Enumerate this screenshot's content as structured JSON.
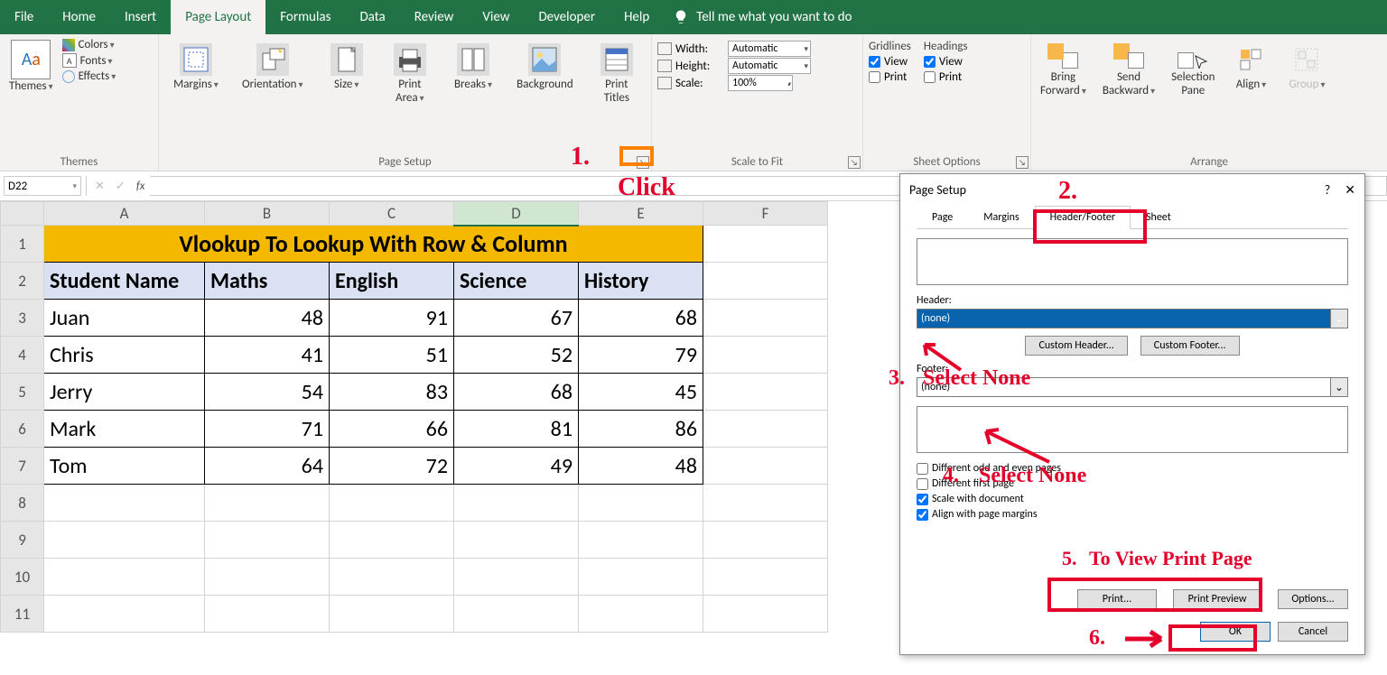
{
  "menubar": {
    "tabs": [
      "File",
      "Home",
      "Insert",
      "Page Layout",
      "Formulas",
      "Data",
      "Review",
      "View",
      "Developer",
      "Help"
    ],
    "active": "Page Layout",
    "tellme": "Tell me what you want to do"
  },
  "ribbon": {
    "themes": {
      "title": "Themes",
      "btn": "Themes",
      "colors": "Colors",
      "fonts": "Fonts",
      "effects": "Effects"
    },
    "page_setup": {
      "title": "Page Setup",
      "margins": "Margins",
      "orientation": "Orientation",
      "size": "Size",
      "print_area": "Print\nArea",
      "breaks": "Breaks",
      "background": "Background",
      "print_titles": "Print\nTitles"
    },
    "scale_to_fit": {
      "title": "Scale to Fit",
      "width": "Width:",
      "height": "Height:",
      "scale": "Scale:",
      "width_val": "Automatic",
      "height_val": "Automatic",
      "scale_val": "100%"
    },
    "sheet_options": {
      "title": "Sheet Options",
      "gridlines": "Gridlines",
      "headings": "Headings",
      "view": "View",
      "print": "Print"
    },
    "arrange": {
      "title": "Arrange",
      "bring_forward": "Bring\nForward",
      "send_backward": "Send\nBackward",
      "selection_pane": "Selection\nPane",
      "align": "Align",
      "group": "Group"
    }
  },
  "namebox": "D22",
  "columns": [
    "A",
    "B",
    "C",
    "D",
    "E",
    "F"
  ],
  "rows": [
    "1",
    "2",
    "3",
    "4",
    "5",
    "6",
    "7",
    "8",
    "9",
    "10",
    "11"
  ],
  "table": {
    "title": "Vlookup To Lookup With Row & Column",
    "headers": [
      "Student Name",
      "Maths",
      "English",
      "Science",
      "History"
    ],
    "data": [
      [
        "Juan",
        "48",
        "91",
        "67",
        "68"
      ],
      [
        "Chris",
        "41",
        "51",
        "52",
        "79"
      ],
      [
        "Jerry",
        "54",
        "83",
        "68",
        "45"
      ],
      [
        "Mark",
        "71",
        "66",
        "81",
        "86"
      ],
      [
        "Tom",
        "64",
        "72",
        "49",
        "48"
      ]
    ]
  },
  "dialog": {
    "title": "Page Setup",
    "help": "?",
    "close": "✕",
    "tabs": [
      "Page",
      "Margins",
      "Header/Footer",
      "Sheet"
    ],
    "active_tab": "Header/Footer",
    "header_label": "Header:",
    "header_val": "(none)",
    "footer_label": "Footer:",
    "footer_val": "(none)",
    "custom_header": "Custom Header...",
    "custom_footer": "Custom Footer...",
    "chk1": "Different odd and even pages",
    "chk2": "Different first page",
    "chk3": "Scale with document",
    "chk4": "Align with page margins",
    "print": "Print...",
    "print_preview": "Print Preview",
    "options": "Options...",
    "ok": "OK",
    "cancel": "Cancel"
  },
  "annotations": {
    "a1": "1.",
    "a1b": "Click",
    "a2": "2.",
    "a3": "3.",
    "a3b": "Select None",
    "a4": "4.",
    "a4b": "Select None",
    "a5": "5.",
    "a5b": "To View Print Page",
    "a6": "6."
  },
  "chart_data": {
    "type": "table",
    "title": "Vlookup To Lookup With Row & Column",
    "columns": [
      "Student Name",
      "Maths",
      "English",
      "Science",
      "History"
    ],
    "rows": [
      {
        "Student Name": "Juan",
        "Maths": 48,
        "English": 91,
        "Science": 67,
        "History": 68
      },
      {
        "Student Name": "Chris",
        "Maths": 41,
        "English": 51,
        "Science": 52,
        "History": 79
      },
      {
        "Student Name": "Jerry",
        "Maths": 54,
        "English": 83,
        "Science": 68,
        "History": 45
      },
      {
        "Student Name": "Mark",
        "Maths": 71,
        "English": 66,
        "Science": 81,
        "History": 86
      },
      {
        "Student Name": "Tom",
        "Maths": 64,
        "English": 72,
        "Science": 49,
        "History": 48
      }
    ]
  }
}
